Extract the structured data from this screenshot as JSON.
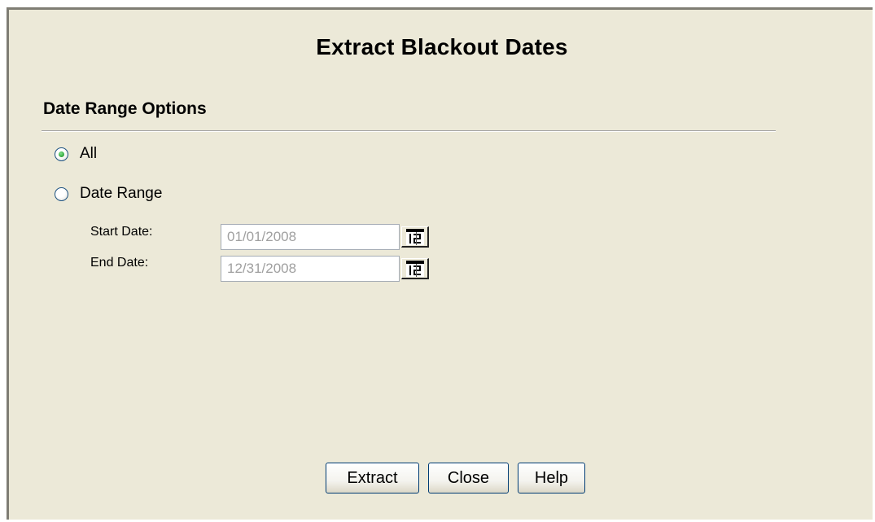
{
  "dialog": {
    "title": "Extract Blackout Dates"
  },
  "date_range_options": {
    "heading": "Date Range Options",
    "options": [
      {
        "label": "All",
        "selected": true
      },
      {
        "label": "Date Range",
        "selected": false
      }
    ]
  },
  "fields": {
    "start_date": {
      "label": "Start Date:",
      "value": "01/01/2008",
      "calendar_icon": "calendar-icon"
    },
    "end_date": {
      "label": "End Date:",
      "value": "12/31/2008",
      "calendar_icon": "calendar-icon"
    }
  },
  "buttons": {
    "extract": "Extract",
    "close": "Close",
    "help": "Help"
  },
  "colors": {
    "dialog_background": "#ece9d8",
    "disabled_text": "#a0a0a0",
    "radio_selected": "#2fa53a"
  }
}
